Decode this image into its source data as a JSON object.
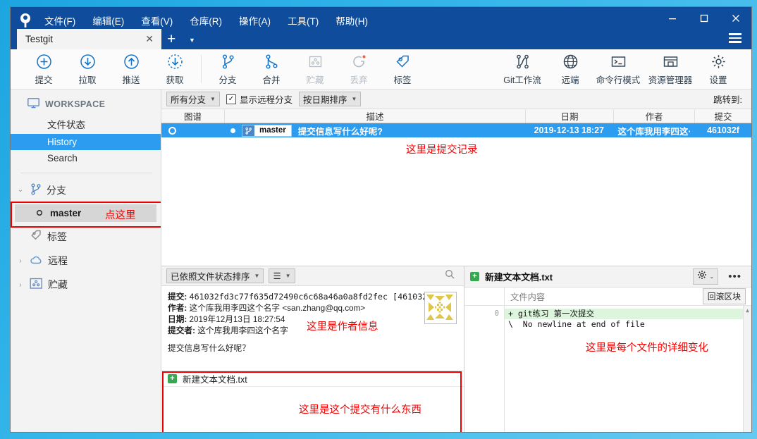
{
  "window": {
    "menus": [
      "文件(F)",
      "编辑(E)",
      "查看(V)",
      "仓库(R)",
      "操作(A)",
      "工具(T)",
      "帮助(H)"
    ],
    "minimize": "—",
    "maximize": "☐",
    "close": "✕",
    "tab_label": "Testgit",
    "tab_close": "✕",
    "new_tab": "+",
    "tab_caret": "▼"
  },
  "toolbar": {
    "left": [
      {
        "label": "提交",
        "icon": "plus-circle-icon",
        "disabled": false
      },
      {
        "label": "拉取",
        "icon": "arrow-down-circle-icon",
        "disabled": false
      },
      {
        "label": "推送",
        "icon": "arrow-up-circle-icon",
        "disabled": false
      },
      {
        "label": "获取",
        "icon": "fetch-dashed-circle-icon",
        "disabled": false
      },
      {
        "label": "分支",
        "icon": "branch-icon",
        "disabled": false
      },
      {
        "label": "合并",
        "icon": "merge-icon",
        "disabled": false
      },
      {
        "label": "贮藏",
        "icon": "stash-box-icon",
        "disabled": true
      },
      {
        "label": "丢弃",
        "icon": "discard-refresh-icon",
        "disabled": true
      },
      {
        "label": "标签",
        "icon": "tag-icon",
        "disabled": false
      }
    ],
    "right": [
      {
        "label": "Git工作流",
        "icon": "gitflow-icon"
      },
      {
        "label": "远端",
        "icon": "globe-icon"
      },
      {
        "label": "命令行模式",
        "icon": "terminal-icon"
      },
      {
        "label": "资源管理器",
        "icon": "folder-explorer-icon"
      },
      {
        "label": "设置",
        "icon": "gear-icon"
      }
    ]
  },
  "sidebar": {
    "workspace_label": "WORKSPACE",
    "workspace_items": [
      "文件状态",
      "History",
      "Search"
    ],
    "selected_item": "History",
    "groups": [
      {
        "label": "分支",
        "icon": "branch-icon",
        "arrow": "⌄",
        "expanded": true
      },
      {
        "label": "标签",
        "icon": "tag-icon",
        "arrow": "",
        "expanded": false
      },
      {
        "label": "远程",
        "icon": "cloud-icon",
        "arrow": "›",
        "expanded": false
      },
      {
        "label": "贮藏",
        "icon": "stash-box-icon",
        "arrow": "›",
        "expanded": false
      }
    ],
    "branch": "master",
    "annotation_click_here": "点这里"
  },
  "history": {
    "filter_branch": "所有分支",
    "show_remote_label": "显示远程分支",
    "show_remote_checked": "✓",
    "sort_label": "按日期排序",
    "jump_to_label": "跳转到:",
    "columns": [
      "图谱",
      "描述",
      "日期",
      "作者",
      "提交"
    ],
    "rows": [
      {
        "branch_chip": "master",
        "description": "提交信息写什么好呢?",
        "date": "2019-12-13 18:27",
        "author": "这个库我用李四这·",
        "hash": "461032f"
      }
    ],
    "annotation": "这里是提交记录"
  },
  "commit_detail": {
    "sort_label": "已依照文件状态排序",
    "list_icon": "☰",
    "search_icon": "search-icon",
    "fields": [
      {
        "key": "提交:",
        "value": "461032fd3c77f635d72490c6c68a46a0a8fd2fec [461032f]"
      },
      {
        "key": "作者:",
        "value": "这个库我用李四这个名字 <san.zhang@qq.com>"
      },
      {
        "key": "日期:",
        "value": "2019年12月13日 18:27:54"
      },
      {
        "key": "提交者:",
        "value": "这个库我用李四这个名字"
      }
    ],
    "message": "提交信息写什么好呢？",
    "annotation": "这里是作者信息",
    "files": [
      {
        "status": "+",
        "name": "新建文本文档.txt"
      }
    ],
    "files_annotation": "这里是这个提交有什么东西"
  },
  "diff": {
    "file_status": "+",
    "file_name": "新建文本文档.txt",
    "gear_icon": "gear-icon",
    "gear_caret": "⌄",
    "more_icon": "•••",
    "content_header": "文件内容",
    "rollback_label": "回滚区块",
    "line_numbers": [
      "0"
    ],
    "lines": [
      {
        "text": "+ git练习 第一次提交",
        "type": "add"
      },
      {
        "text": "\\  No newline at end of file",
        "type": "meta"
      }
    ],
    "annotation": "这里是每个文件的详细变化"
  },
  "colors": {
    "titlebar": "#0f4c9c",
    "accent_blue": "#2c9cf0",
    "annotation_red": "#f40000",
    "add_green": "#ddf5dd",
    "status_green": "#36a84f"
  }
}
